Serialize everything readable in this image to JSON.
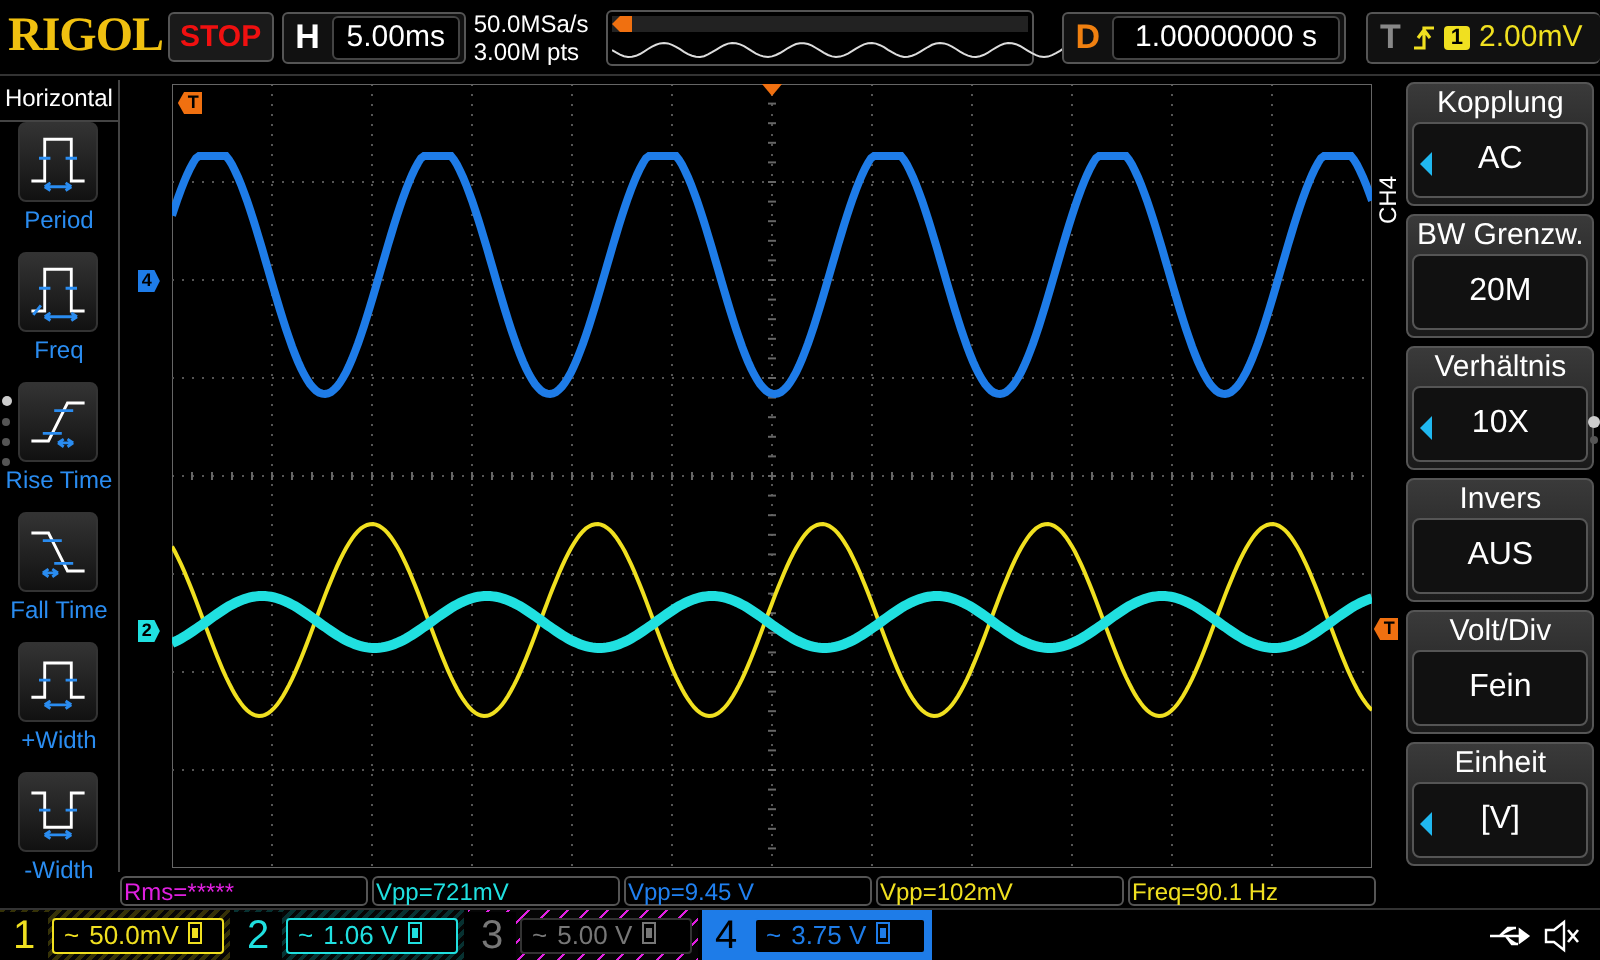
{
  "header": {
    "logo": "RIGOL",
    "run_state": "STOP",
    "timebase": {
      "label": "H",
      "value": "5.00ms"
    },
    "sample_rate": "50.0MSa/s",
    "memory_depth": "3.00M pts",
    "delay": {
      "label": "D",
      "value": "1.00000000 s"
    },
    "trigger": {
      "label": "T",
      "source": "1",
      "level": "2.00mV"
    }
  },
  "horizontal_menu": {
    "title": "Horizontal",
    "items": [
      {
        "label": "Period",
        "kind": "period"
      },
      {
        "label": "Freq",
        "kind": "freq"
      },
      {
        "label": "Rise Time",
        "kind": "rise"
      },
      {
        "label": "Fall Time",
        "kind": "fall"
      },
      {
        "label": "+Width",
        "kind": "pwidth"
      },
      {
        "label": "-Width",
        "kind": "nwidth"
      }
    ],
    "pages": [
      {
        "selected": true
      },
      {
        "selected": false
      },
      {
        "selected": false
      },
      {
        "selected": false
      }
    ]
  },
  "screen": {
    "markers": [
      {
        "label": "T",
        "kind": "trigger_position"
      },
      {
        "label": "4",
        "kind": "offset_4"
      },
      {
        "label": "2",
        "kind": "offset_2"
      },
      {
        "label": "T",
        "kind": "trigger_level"
      }
    ]
  },
  "soft_menu": {
    "channel": "CH4",
    "items": [
      {
        "title": "Kopplung",
        "value": "AC",
        "adjustable": true
      },
      {
        "title": "BW Grenzw.",
        "value": "20M",
        "adjustable": false
      },
      {
        "title": "Verhältnis",
        "value": "10X",
        "adjustable": true
      },
      {
        "title": "Invers",
        "value": "AUS",
        "adjustable": false
      },
      {
        "title": "Volt/Div",
        "value": "Fein",
        "adjustable": false
      },
      {
        "title": "Einheit",
        "value": "[V]",
        "adjustable": true
      }
    ],
    "pages": [
      {
        "selected": true
      },
      {
        "selected": false
      }
    ]
  },
  "measurements": [
    {
      "text": "Rms=*****",
      "color": "#e020e0"
    },
    {
      "text": "Vpp=721mV",
      "color": "#20e0e0"
    },
    {
      "text": "Vpp=9.45 V",
      "color": "#2080f0"
    },
    {
      "text": "Vpp=102mV",
      "color": "#f0e020"
    },
    {
      "text": "Freq=90.1 Hz",
      "color": "#f0e020"
    }
  ],
  "channels": [
    {
      "number": "1",
      "coupling": "~",
      "scale": "50.0mV",
      "color": "#f0e020",
      "enabled": true,
      "selected": false
    },
    {
      "number": "2",
      "coupling": "~",
      "scale": "1.06 V",
      "color": "#20e0e0",
      "enabled": true,
      "selected": false
    },
    {
      "number": "3",
      "coupling": "~",
      "scale": "5.00 V",
      "color": "#e020e0",
      "enabled": false,
      "selected": false
    },
    {
      "number": "4",
      "coupling": "~",
      "scale": "3.75 V",
      "color": "#1e7ce8",
      "enabled": true,
      "selected": true
    }
  ]
}
